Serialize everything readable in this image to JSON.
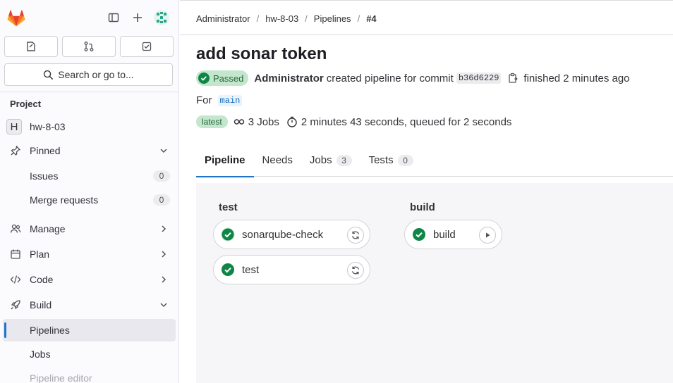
{
  "sidebar": {
    "search_label": "Search or go to...",
    "section_title": "Project",
    "project": {
      "initial": "H",
      "name": "hw-8-03"
    },
    "items": [
      {
        "label": "Pinned",
        "icon": "pin-icon"
      },
      {
        "label": "Issues",
        "count": "0"
      },
      {
        "label": "Merge requests",
        "count": "0"
      },
      {
        "label": "Manage",
        "icon": "users-icon"
      },
      {
        "label": "Plan",
        "icon": "calendar-icon"
      },
      {
        "label": "Code",
        "icon": "code-icon"
      },
      {
        "label": "Build",
        "icon": "rocket-icon"
      },
      {
        "label": "Pipelines"
      },
      {
        "label": "Jobs"
      },
      {
        "label": "Pipeline editor"
      }
    ]
  },
  "breadcrumb": [
    "Administrator",
    "hw-8-03",
    "Pipelines",
    "#4"
  ],
  "pipeline": {
    "title": "add sonar token",
    "status": "Passed",
    "author": "Administrator",
    "created_text": "created pipeline for commit",
    "commit_sha": "b36d6229",
    "finished_text": "finished 2 minutes ago",
    "for_label": "For",
    "ref": "main",
    "latest_badge": "latest",
    "jobs_text": "3 Jobs",
    "duration_text": "2 minutes 43 seconds, queued for 2 seconds"
  },
  "tabs": [
    {
      "label": "Pipeline"
    },
    {
      "label": "Needs"
    },
    {
      "label": "Jobs",
      "count": "3"
    },
    {
      "label": "Tests",
      "count": "0"
    }
  ],
  "stages": [
    {
      "name": "test",
      "jobs": [
        "sonarqube-check",
        "test"
      ]
    },
    {
      "name": "build",
      "jobs": [
        "build"
      ]
    }
  ],
  "colors": {
    "accent": "#1f75cb",
    "success": "#108548",
    "success_bg": "#c3e6cd"
  }
}
